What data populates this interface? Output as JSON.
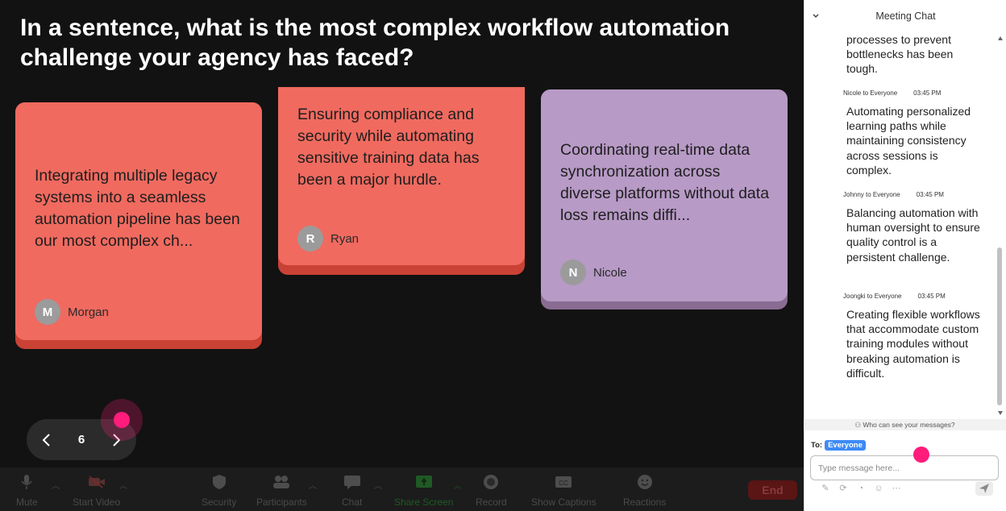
{
  "question": "In a sentence, what is the most complex workflow automation challenge your agency has faced?",
  "cards": [
    {
      "text": "Integrating multiple legacy systems into a seamless automation pipeline has been our most complex ch...",
      "initial": "M",
      "author": "Morgan",
      "color": "#f06a5f"
    },
    {
      "text": "Ensuring compliance and security while automating sensitive training data has been a major hurdle.",
      "initial": "R",
      "author": "Ryan",
      "color": "#f06a5f"
    },
    {
      "text": "Coordinating real-time data synchronization across diverse platforms without data loss remains diffi...",
      "initial": "N",
      "author": "Nicole",
      "color": "#b79ac6"
    }
  ],
  "pager": {
    "page": "6"
  },
  "toolbar": {
    "mute": "Mute",
    "start_video": "Start Video",
    "security": "Security",
    "participants": "Participants",
    "chat": "Chat",
    "share_screen": "Share Screen",
    "record": "Record",
    "show_captions": "Show Captions",
    "reactions": "Reactions",
    "end": "End"
  },
  "chat": {
    "title": "Meeting Chat",
    "messages": [
      {
        "sender": "",
        "time": "",
        "text": "processes to prevent bottlenecks has been tough."
      },
      {
        "sender": "Nicole to Everyone",
        "time": "03:45 PM",
        "text": "Automating personalized learning paths while maintaining consistency across sessions is complex."
      },
      {
        "sender": "Johnny to Everyone",
        "time": "03:45 PM",
        "text": "Balancing automation with human oversight to ensure quality control is a persistent challenge."
      },
      {
        "sender": "Joongki to Everyone",
        "time": "03:45 PM",
        "text": "Creating flexible workflows that accommodate custom training modules without breaking automation is difficult."
      }
    ],
    "who_can_see": "Who can see your messages?",
    "to_label": "To:",
    "to_value": "Everyone",
    "input_placeholder": "Type message here..."
  },
  "colors": {
    "accent": "#3d8af7",
    "pointer": "#ff1c7b",
    "card_red": "#f06a5f",
    "card_purple": "#b79ac6"
  }
}
